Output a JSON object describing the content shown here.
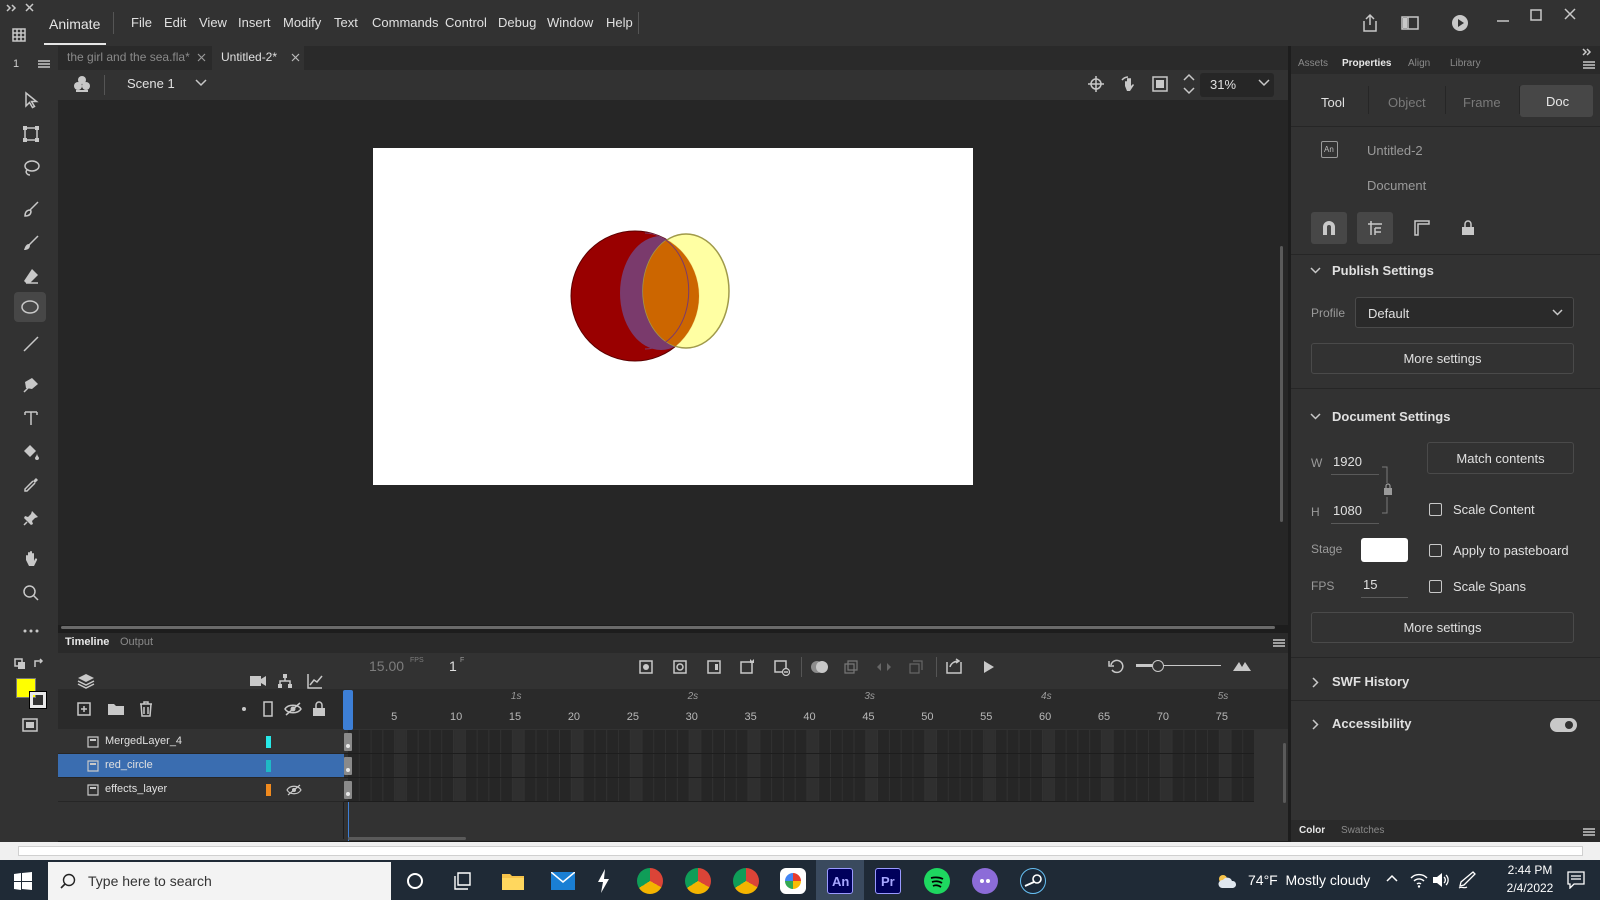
{
  "app": {
    "name": "Animate"
  },
  "menu": [
    "File",
    "Edit",
    "View",
    "Insert",
    "Modify",
    "Text",
    "Commands",
    "Control",
    "Debug",
    "Window",
    "Help"
  ],
  "toolbar_number": "1",
  "doc_tabs": [
    {
      "label": "the girl and the sea.fla*",
      "active": false
    },
    {
      "label": "Untitled-2*",
      "active": true
    }
  ],
  "scene": {
    "name": "Scene 1",
    "zoom": "31%"
  },
  "timeline": {
    "tabs": [
      "Timeline",
      "Output"
    ],
    "fps": "15.00",
    "fps_unit": "FPS",
    "frame": "1",
    "frame_unit": "F",
    "seconds": [
      "1s",
      "2s",
      "3s",
      "4s",
      "5s"
    ],
    "frame_numbers": [
      "5",
      "10",
      "15",
      "20",
      "25",
      "30",
      "35",
      "40",
      "45",
      "50",
      "55",
      "60",
      "65",
      "70",
      "75"
    ],
    "layers": [
      {
        "name": "MergedLayer_4",
        "color": "#27e8e8",
        "selected": false
      },
      {
        "name": "red_circle",
        "color": "#1fb9c4",
        "selected": true
      },
      {
        "name": "effects_layer",
        "color": "#f08a1e",
        "selected": false
      }
    ]
  },
  "panel": {
    "tabs": [
      "Assets",
      "Properties",
      "Align",
      "Library"
    ],
    "active_tab": "Properties",
    "subtabs": [
      "Tool",
      "Object",
      "Frame",
      "Doc"
    ],
    "doc_name": "Untitled-2",
    "doc_type": "Document",
    "publish": {
      "title": "Publish Settings",
      "profile_label": "Profile",
      "profile_value": "Default",
      "more": "More settings"
    },
    "document": {
      "title": "Document Settings",
      "w_label": "W",
      "w": "1920",
      "h_label": "H",
      "h": "1080",
      "match": "Match contents",
      "scale_content": "Scale Content",
      "stage_label": "Stage",
      "apply_pasteboard": "Apply to pasteboard",
      "fps_label": "FPS",
      "fps": "15",
      "scale_spans": "Scale Spans",
      "more": "More settings"
    },
    "swf_history": "SWF History",
    "accessibility": "Accessibility",
    "bottom_tabs": [
      "Color",
      "Swatches"
    ]
  },
  "colors": {
    "fill": "#ffff00",
    "stroke": "#000000",
    "stage": "#ffffff"
  },
  "taskbar": {
    "search_placeholder": "Type here to search",
    "weather": "74°F  Mostly cloudy",
    "time": "2:44 PM",
    "date": "2/4/2022",
    "apps": [
      "An",
      "Pr"
    ]
  }
}
